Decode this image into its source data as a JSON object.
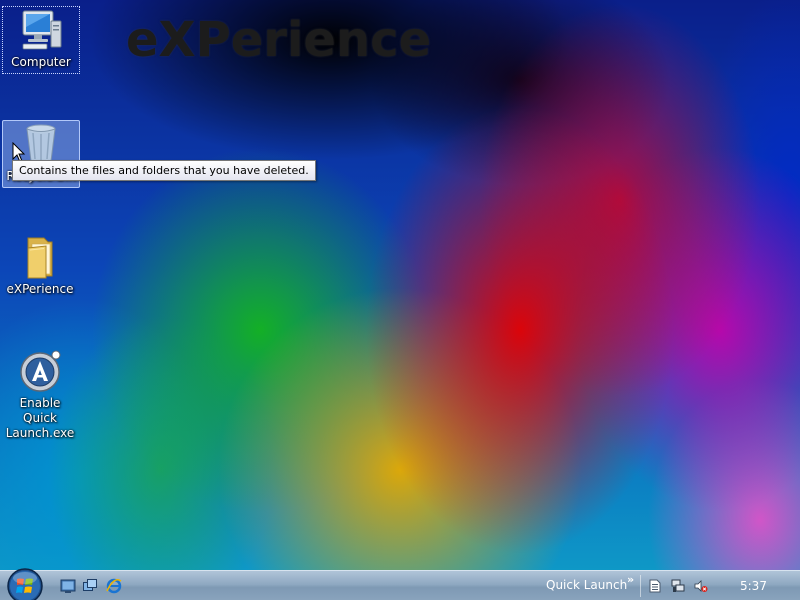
{
  "wallpaper": {
    "watermark_text": "eXPerience",
    "colors": {
      "base": "#0a2a9a",
      "red": "#e60000",
      "green": "#14b41e",
      "yellow": "#e6aa00",
      "magenta": "#c800aa",
      "cyan": "#0096d2"
    }
  },
  "desktop_icons": [
    {
      "name": "computer-icon",
      "label": "Computer",
      "selected": "focus"
    },
    {
      "name": "recycle-bin-icon",
      "label": "Recycle Bin",
      "selected": "highlight"
    },
    {
      "name": "folder-icon",
      "label": "eXPerience"
    },
    {
      "name": "quick-launch-app-icon",
      "label": "Enable Quick Launch.exe"
    }
  ],
  "tooltip": {
    "text": "Contains the files and folders that you have deleted."
  },
  "taskbar": {
    "start_icon": "windows-orb-icon",
    "quick_launch_icons": [
      "show-desktop-icon",
      "switch-windows-icon",
      "internet-explorer-icon"
    ],
    "quick_launch_label": "Quick Launch",
    "chevron": "»",
    "tray_icons": [
      "document-icon",
      "network-icon",
      "volume-muted-icon"
    ],
    "clock": "5:37",
    "colors": {
      "bar_top": "#b0c4d8",
      "bar_bottom": "#7e99b4"
    }
  }
}
